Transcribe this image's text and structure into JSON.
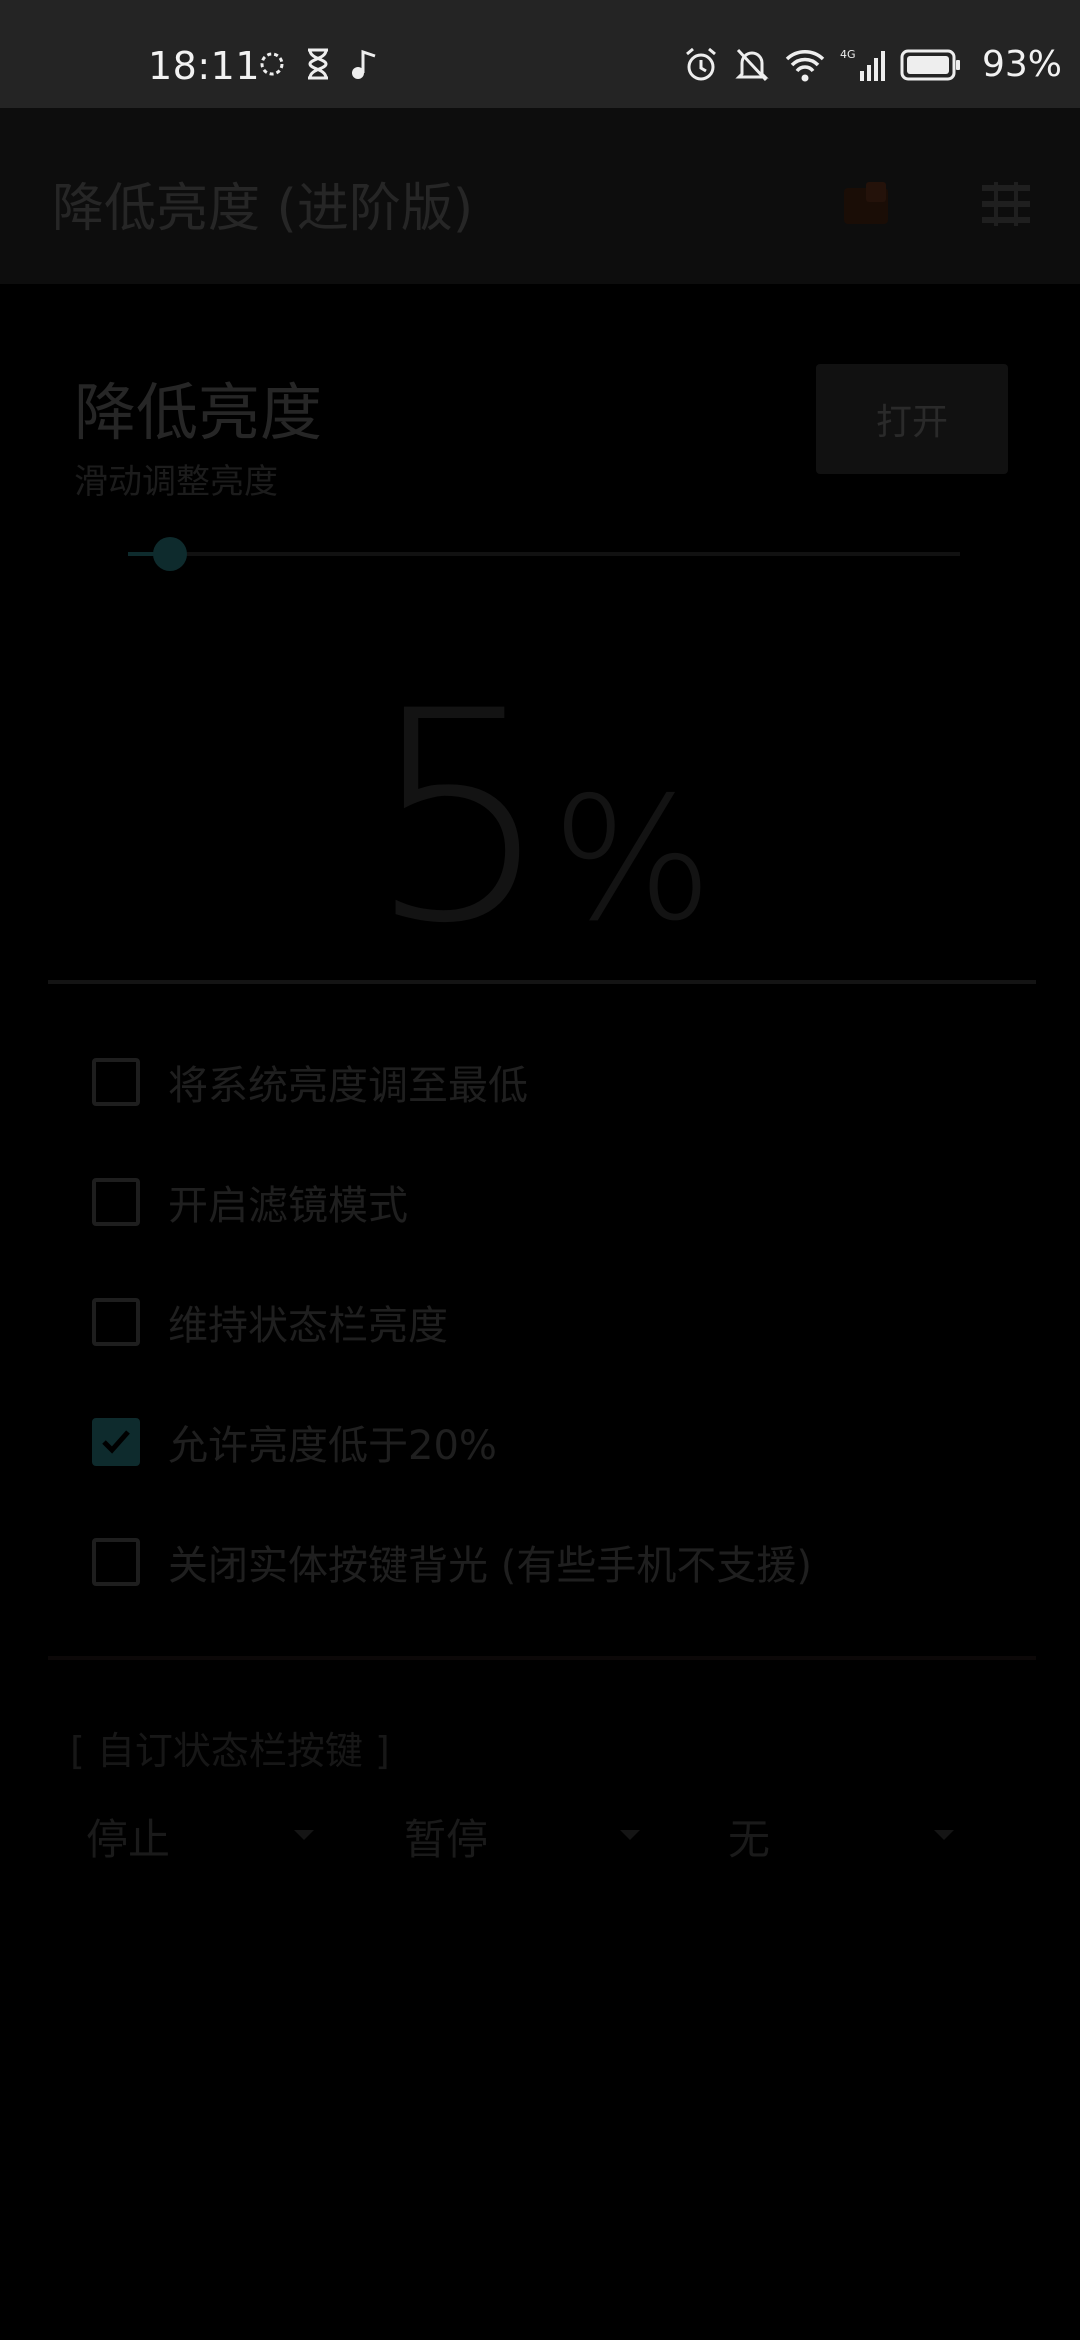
{
  "status_bar": {
    "time": "18:11",
    "battery_percent": "93%",
    "network": "4G",
    "left_icons": [
      "sync-circle-icon",
      "hourglass-icon",
      "music-note-icon"
    ],
    "right_icons": [
      "alarm-icon",
      "bell-off-icon",
      "wifi-icon",
      "signal-icon",
      "battery-icon"
    ]
  },
  "app_bar": {
    "title": "降低亮度 (进阶版)",
    "icons": [
      "app-badge-icon",
      "menu-icon"
    ]
  },
  "main": {
    "title": "降低亮度",
    "subtitle": "滑动调整亮度",
    "open_button": "打开",
    "slider_fraction": 0.05,
    "percent_number": "5",
    "percent_sign": "%",
    "accent_color": "#0e2b2d"
  },
  "options": [
    {
      "label": "将系统亮度调至最低",
      "checked": false
    },
    {
      "label": "开启滤镜模式",
      "checked": false
    },
    {
      "label": "维持状态栏亮度",
      "checked": false
    },
    {
      "label": "允许亮度低于20%",
      "checked": true
    },
    {
      "label": "关闭实体按键背光 (有些手机不支援)",
      "checked": false
    }
  ],
  "status_keys": {
    "section_title": "[ 自订状态栏按键 ]",
    "selects": [
      "停止",
      "暂停",
      "无"
    ]
  }
}
